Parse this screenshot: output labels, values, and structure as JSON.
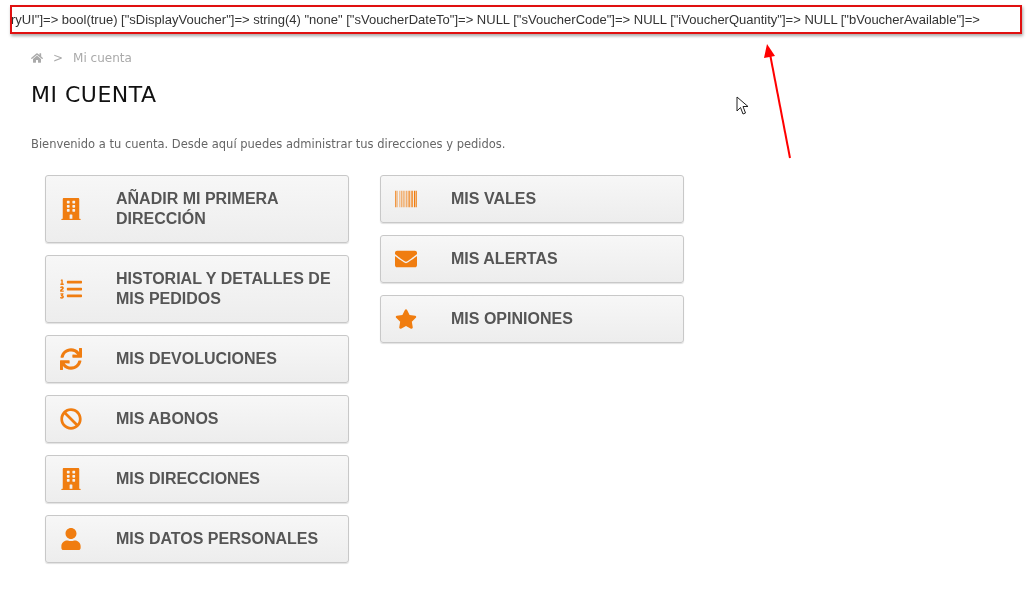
{
  "debug_output": "ryUI\"]=> bool(true) [\"sDisplayVoucher\"]=> string(4) \"none\" [\"sVoucherDateTo\"]=> NULL [\"sVoucherCode\"]=> NULL [\"iVoucherQuantity\"]=> NULL [\"bVoucherAvailable\"]=>",
  "breadcrumb": {
    "separator": ">",
    "current": "Mi cuenta"
  },
  "title": "MI CUENTA",
  "welcome": "Bienvenido a tu cuenta. Desde aquí puedes administrar tus direcciones y pedidos.",
  "columns": [
    [
      {
        "kind": "building",
        "label": "AÑADIR MI PRIMERA DIRECCIÓN"
      },
      {
        "kind": "list",
        "label": "HISTORIAL Y DETALLES DE MIS PEDIDOS"
      },
      {
        "kind": "refresh",
        "label": "MIS DEVOLUCIONES"
      },
      {
        "kind": "ban",
        "label": "MIS ABONOS"
      },
      {
        "kind": "building",
        "label": "MIS DIRECCIONES"
      },
      {
        "kind": "user",
        "label": "MIS DATOS PERSONALES"
      }
    ],
    [
      {
        "kind": "barcode",
        "label": "MIS VALES"
      },
      {
        "kind": "envelope",
        "label": "MIS ALERTAS"
      },
      {
        "kind": "star",
        "label": "MIS OPINIONES"
      }
    ]
  ]
}
